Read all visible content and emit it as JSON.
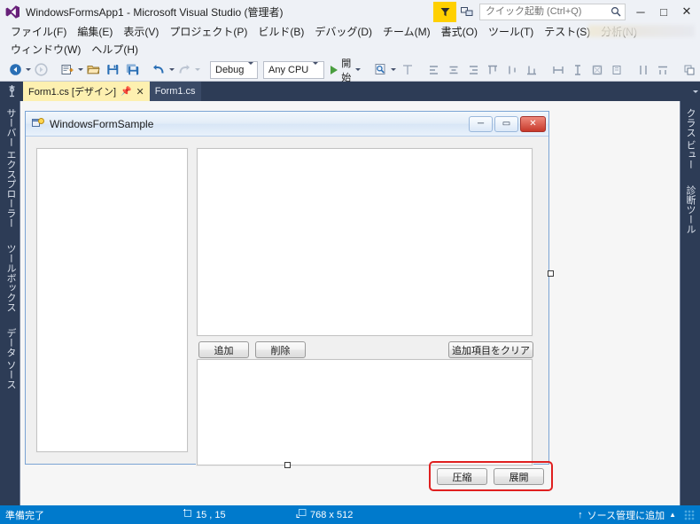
{
  "window": {
    "title": "WindowsFormsApp1 - Microsoft Visual Studio",
    "admin_suffix": "(管理者)",
    "logo_icon": "visual-studio-logo",
    "controls": {
      "minimize": "─",
      "maximize": "□",
      "close": "✕"
    },
    "feedback_icon": "feedback-funnel-icon",
    "signin_icon": "sign-in-icon"
  },
  "quick_launch": {
    "placeholder": "クイック起動 (Ctrl+Q)",
    "value": "",
    "icon": "search-icon"
  },
  "menus": {
    "row1": [
      {
        "label": "ファイル(F)",
        "name": "menu-file"
      },
      {
        "label": "編集(E)",
        "name": "menu-edit"
      },
      {
        "label": "表示(V)",
        "name": "menu-view"
      },
      {
        "label": "プロジェクト(P)",
        "name": "menu-project"
      },
      {
        "label": "ビルド(B)",
        "name": "menu-build"
      },
      {
        "label": "デバッグ(D)",
        "name": "menu-debug"
      },
      {
        "label": "チーム(M)",
        "name": "menu-team"
      },
      {
        "label": "書式(O)",
        "name": "menu-format"
      },
      {
        "label": "ツール(T)",
        "name": "menu-tools"
      },
      {
        "label": "テスト(S)",
        "name": "menu-test"
      },
      {
        "label": "分析(N)",
        "name": "menu-analyze"
      }
    ],
    "row2": [
      {
        "label": "ウィンドウ(W)",
        "name": "menu-window"
      },
      {
        "label": "ヘルプ(H)",
        "name": "menu-help"
      }
    ]
  },
  "toolbar": {
    "navigate_back_icon": "navigate-back-icon",
    "navigate_forward_icon": "navigate-forward-icon",
    "new_project_icon": "new-project-icon",
    "open_file_icon": "open-file-icon",
    "save_icon": "save-icon",
    "save_all_icon": "save-all-icon",
    "undo_icon": "undo-icon",
    "redo_icon": "redo-icon",
    "configuration": {
      "value": "Debug",
      "name": "configuration-combo"
    },
    "platform": {
      "value": "Any CPU",
      "name": "platform-combo"
    },
    "start": {
      "label": "開始",
      "name": "start-debug-button"
    },
    "find_icon": "find-in-files-icon",
    "layout_icons": [
      "align-lefts-icon",
      "align-centers-icon",
      "align-rights-icon",
      "align-tops-icon",
      "align-middles-icon",
      "align-bottoms-icon",
      "make-same-width-icon",
      "make-same-height-icon",
      "make-same-size-icon",
      "size-to-grid-icon",
      "horizontal-spacing-icon",
      "vertical-spacing-icon",
      "bring-to-front-icon",
      "send-to-back-icon"
    ]
  },
  "tabs": {
    "pin_rail_icon": "pin-rail-icon",
    "items": [
      {
        "label": "Form1.cs [デザイン]",
        "active": true,
        "name": "tab-form1-design",
        "pin_icon": "pin-icon",
        "close_icon": "close-icon"
      },
      {
        "label": "Form1.cs",
        "active": false,
        "name": "tab-form1-code"
      }
    ],
    "overflow_icon": "tab-overflow-icon"
  },
  "left_rail": [
    {
      "label": "サーバー エクスプローラー",
      "name": "rail-server-explorer"
    },
    {
      "label": "ツールボックス",
      "name": "rail-toolbox"
    },
    {
      "label": "データ ソース",
      "name": "rail-data-sources"
    }
  ],
  "right_rail": [
    {
      "label": "クラス ビュー",
      "name": "rail-class-view"
    },
    {
      "label": "診断ツール",
      "name": "rail-diagnostic-tools"
    }
  ],
  "designer": {
    "form": {
      "title": "WindowsFormSample",
      "icon": "winforms-form-icon",
      "minimize": "─",
      "maximize": "▭",
      "close": "✕",
      "listboxes": [
        {
          "name": "listbox-left",
          "items": []
        },
        {
          "name": "listbox-top",
          "items": []
        },
        {
          "name": "listbox-bottom",
          "items": []
        }
      ],
      "buttons": [
        {
          "label": "追加",
          "name": "button-add"
        },
        {
          "label": "削除",
          "name": "button-delete"
        },
        {
          "label": "追加項目をクリア",
          "name": "button-clear-added-items"
        },
        {
          "label": "圧縮",
          "name": "button-compress"
        },
        {
          "label": "展開",
          "name": "button-expand"
        }
      ],
      "highlight_color": "#e02020"
    }
  },
  "statusbar": {
    "ready": "準備完了",
    "position_icon": "position-icon",
    "position": "15 , 15",
    "size_icon": "size-icon",
    "size": "768 x 512",
    "source_control": "ソース管理に追加",
    "source_control_up_icon": "↑",
    "source_control_caret": "▲"
  },
  "colors": {
    "chrome": "#eef1f6",
    "tabstrip": "#2d3c56",
    "active_tab": "#fdf0b0",
    "statusbar": "#007acc",
    "accent_feedback": "#ffd000",
    "highlight": "#e02020"
  }
}
